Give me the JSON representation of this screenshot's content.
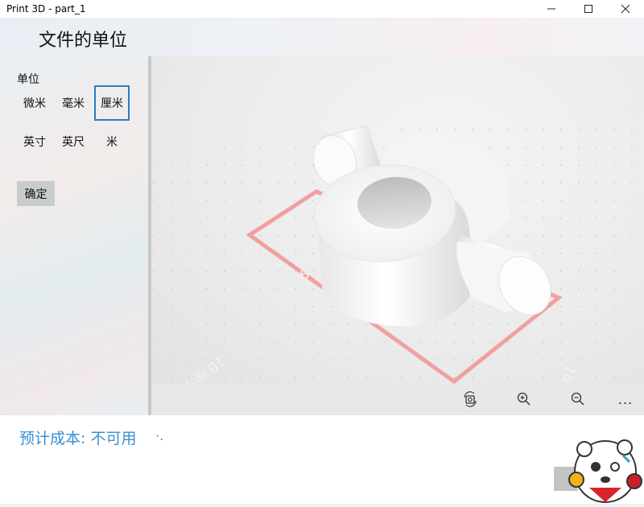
{
  "window": {
    "title": "Print 3D - part_1"
  },
  "header": {
    "title": "文件的单位"
  },
  "units": {
    "label": "单位",
    "options": [
      "微米",
      "毫米",
      "厘米",
      "英寸",
      "英尺",
      "米"
    ],
    "selected": "厘米"
  },
  "confirm_label": "确定",
  "viewport": {
    "dimension_labels": [
      "5 厘米",
      "10 厘米",
      "10 厘米"
    ]
  },
  "toolbar": {
    "icons": [
      "view-reset-icon",
      "zoom-in-icon",
      "zoom-out-icon",
      "more-icon"
    ],
    "more_label": "..."
  },
  "cost": {
    "text": "预计成本: 不可用",
    "suffix": "·."
  }
}
